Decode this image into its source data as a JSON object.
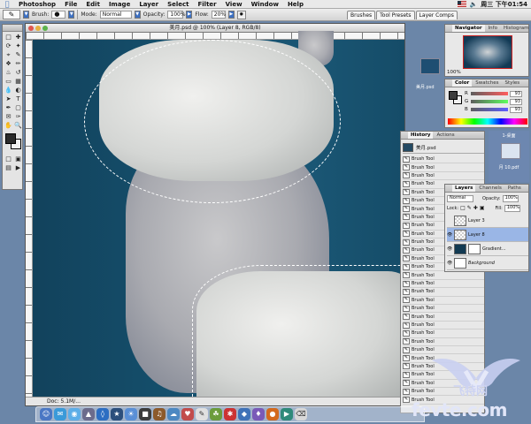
{
  "menubar": {
    "items": [
      "Photoshop",
      "File",
      "Edit",
      "Image",
      "Layer",
      "Select",
      "Filter",
      "View",
      "Window",
      "Help"
    ],
    "clock": "周三 下午01:54"
  },
  "options_bar": {
    "tool_name": "Brush:",
    "mode_label": "Mode:",
    "mode_value": "Normal",
    "opacity_label": "Opacity:",
    "opacity_value": "100%",
    "flow_label": "Flow:",
    "flow_value": "20%",
    "well_tabs": [
      "Brushes",
      "Tool Presets",
      "Layer Comps"
    ]
  },
  "document": {
    "title": "美月.psd @ 100% (Layer 8, RGB/8)",
    "status": "Doc: 5.1M/..."
  },
  "navigator": {
    "tabs": [
      "Navigator",
      "Info",
      "Histogram"
    ],
    "zoom": "100%",
    "desktop_label": "美月.psd"
  },
  "color_palette": {
    "tabs": [
      "Color",
      "Swatches",
      "Styles"
    ],
    "r_label": "R",
    "g_label": "G",
    "b_label": "B",
    "r_value": "93",
    "g_value": "93",
    "b_value": "93"
  },
  "history": {
    "tabs": [
      "History",
      "Actions"
    ],
    "snapshot": "美月.psd",
    "items": [
      "Brush Tool",
      "Brush Tool",
      "Brush Tool",
      "Brush Tool",
      "Brush Tool",
      "Brush Tool",
      "Brush Tool",
      "Brush Tool",
      "Brush Tool",
      "Brush Tool",
      "Brush Tool",
      "Brush Tool",
      "Brush Tool",
      "Brush Tool",
      "Brush Tool",
      "Brush Tool",
      "Brush Tool",
      "Brush Tool",
      "Brush Tool",
      "Brush Tool",
      "Brush Tool",
      "Brush Tool",
      "Brush Tool",
      "Brush Tool",
      "Brush Tool",
      "Brush Tool",
      "Brush Tool",
      "Brush Tool",
      "Brush Tool",
      "Brush Tool"
    ]
  },
  "layers": {
    "tabs": [
      "Layers",
      "Channels",
      "Paths"
    ],
    "blend_mode": "Normal",
    "opacity_label": "Opacity:",
    "opacity_value": "100%",
    "lock_label": "Lock:",
    "fill_label": "Fill:",
    "fill_value": "100%",
    "rows": [
      {
        "name": "Layer 3"
      },
      {
        "name": "Layer 8"
      },
      {
        "name": "Gradient..."
      },
      {
        "name": "Background"
      }
    ]
  },
  "desktop": {
    "label_a": "1-桌面",
    "label_b": "月 10.pdf"
  },
  "watermark": {
    "cn": "飞特网",
    "en": "fevte.com"
  },
  "colors": {
    "canvas_bg": "#15506d",
    "accent": "#3b6fc2"
  }
}
